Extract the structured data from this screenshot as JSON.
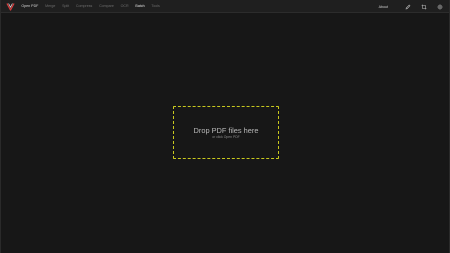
{
  "app": {
    "logo_icon": "v-logo-icon",
    "accent_color": "#c8c81e",
    "logo_colors": [
      "#d63c3c",
      "#e0e0e0"
    ]
  },
  "toolbar": {
    "menu": [
      {
        "label": "Open PDF",
        "state": "primary"
      },
      {
        "label": "Merge",
        "state": "disabled"
      },
      {
        "label": "Split",
        "state": "disabled"
      },
      {
        "label": "Compress",
        "state": "disabled"
      },
      {
        "label": "Compare",
        "state": "disabled"
      },
      {
        "label": "OCR",
        "state": "disabled"
      },
      {
        "label": "Batch",
        "state": "active"
      },
      {
        "label": "Tools",
        "state": "disabled"
      }
    ],
    "about_label": "About",
    "icons": [
      "edit-pen-icon",
      "crop-icon",
      "settings-gear-icon"
    ]
  },
  "dropzone": {
    "title": "Drop PDF files here",
    "subtitle": "or click Open PDF"
  }
}
